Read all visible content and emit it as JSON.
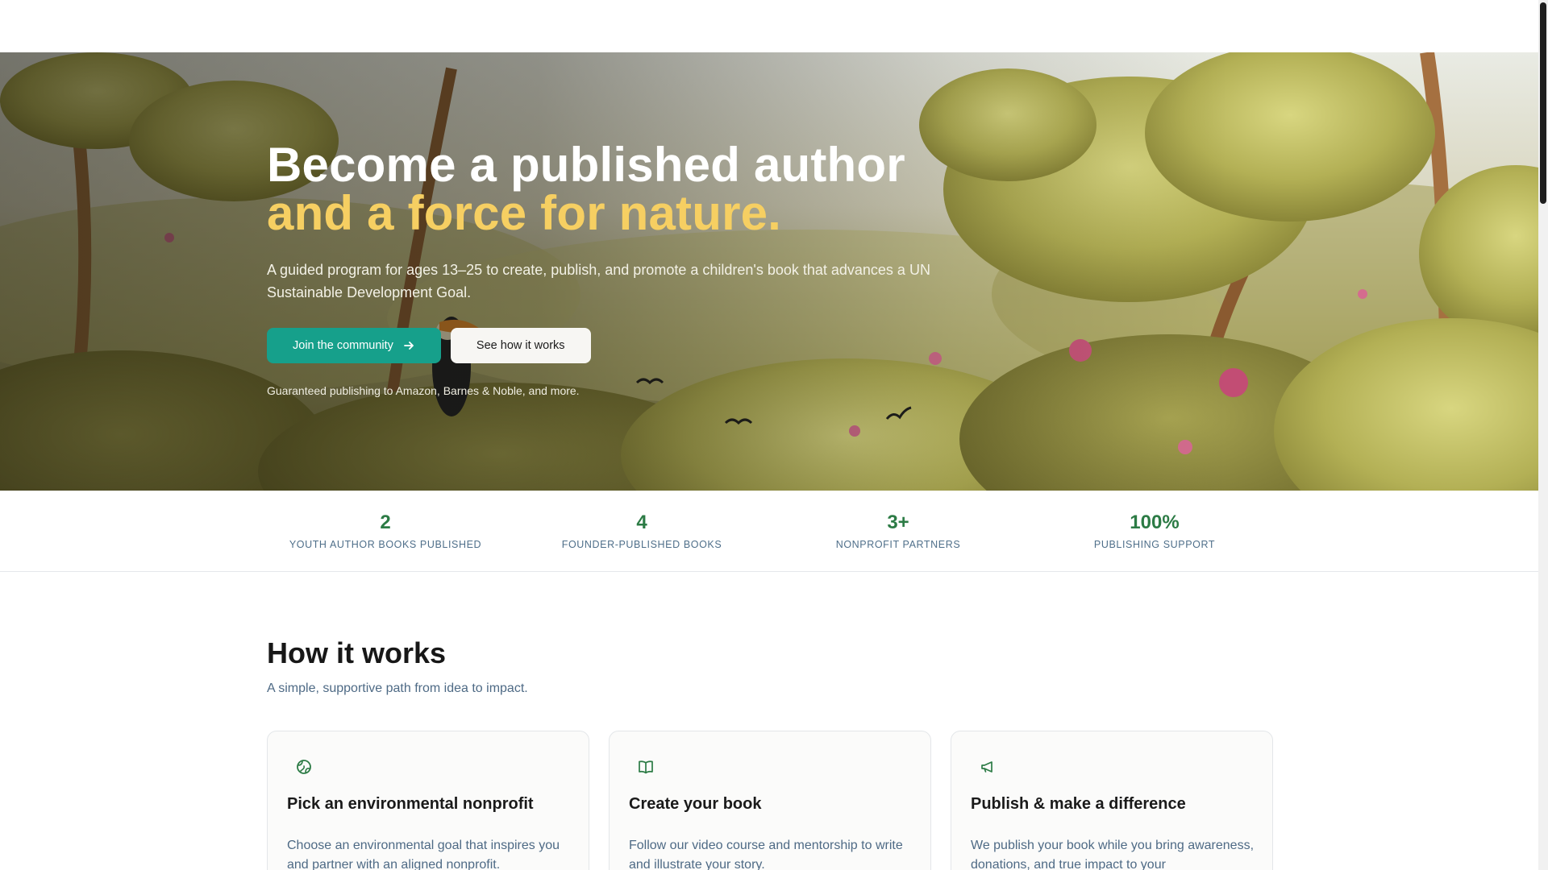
{
  "hero": {
    "title_line1": "Become a published author",
    "title_line2": "and a force for nature.",
    "lead": "A guided program for ages 13–25 to create, publish, and promote a children's book that advances a UN Sustainable Development Goal.",
    "primary_button": "Join the community",
    "secondary_button": "See how it works",
    "note": "Guaranteed publishing to Amazon, Barnes & Noble, and more."
  },
  "stats": [
    {
      "value": "2",
      "label": "YOUTH AUTHOR BOOKS PUBLISHED"
    },
    {
      "value": "4",
      "label": "FOUNDER-PUBLISHED BOOKS"
    },
    {
      "value": "3+",
      "label": "NONPROFIT PARTNERS"
    },
    {
      "value": "100%",
      "label": "PUBLISHING SUPPORT"
    }
  ],
  "how": {
    "title": "How it works",
    "subtitle": "A simple, supportive path from idea to impact.",
    "cards": [
      {
        "icon": "globe-icon",
        "title": "Pick an environmental nonprofit",
        "text": "Choose an environmental goal that inspires you and partner with an aligned nonprofit."
      },
      {
        "icon": "book-open-icon",
        "title": "Create your book",
        "text": "Follow our video course and mentorship to write and illustrate your story."
      },
      {
        "icon": "megaphone-icon",
        "title": "Publish & make a difference",
        "text": "We publish your book while you bring awareness, donations, and true impact to your"
      }
    ]
  },
  "colors": {
    "accent": "#16a08b",
    "highlight": "#f6cf62",
    "stat_number": "#2c7b45",
    "muted_text": "#4e6a85"
  }
}
